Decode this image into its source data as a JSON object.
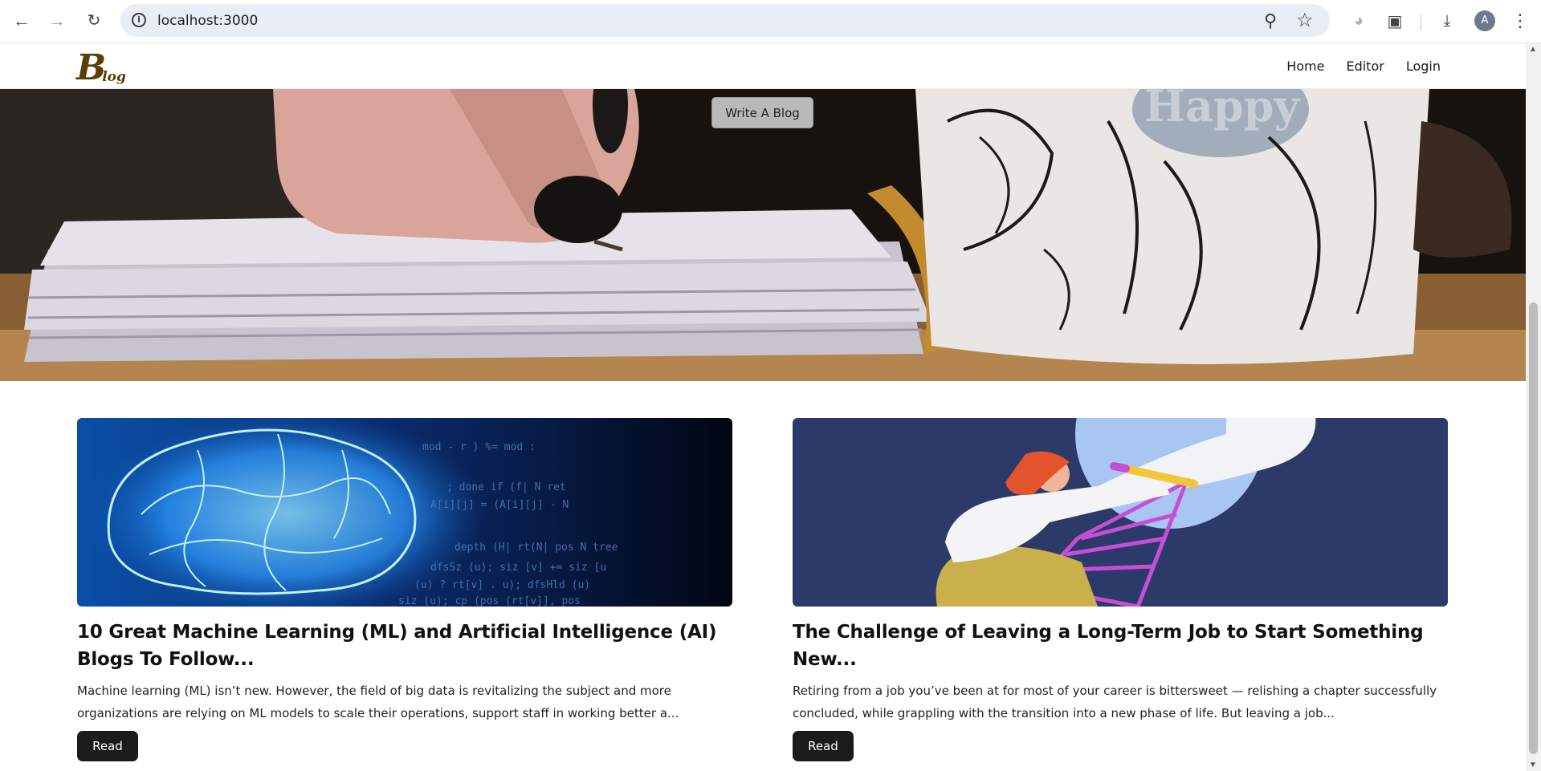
{
  "browser": {
    "url": "localhost:3000",
    "profile_initial": "A"
  },
  "site": {
    "logo_big": "B",
    "logo_small": "log",
    "nav": [
      "Home",
      "Editor",
      "Login"
    ],
    "hero_button": "Write A Blog",
    "hero_cup_text": "Happy"
  },
  "posts": [
    {
      "title": "10 Great Machine Learning (ML) and Artificial Intelligence (AI) Blogs To Follow...",
      "excerpt": "Machine learning (ML) isn’t new. However, the field of big data is revitalizing the subject and more organizations are relying on ML models to scale their operations, support staff in working better a...",
      "read_label": "Read"
    },
    {
      "title": "The Challenge of Leaving a Long-Term Job to Start Something New...",
      "excerpt": "Retiring from a job you’ve been at for most of your career is bittersweet — relishing a chapter successfully concluded, while grappling with the transition into a new phase of life. But leaving a job...",
      "read_label": "Read"
    }
  ],
  "icons": [
    "back-arrow-icon",
    "forward-arrow-icon",
    "reload-icon",
    "site-info-icon",
    "zoom-icon",
    "bookmark-star-icon",
    "extension-puzzle-icon",
    "download-icon",
    "more-menu-icon"
  ]
}
